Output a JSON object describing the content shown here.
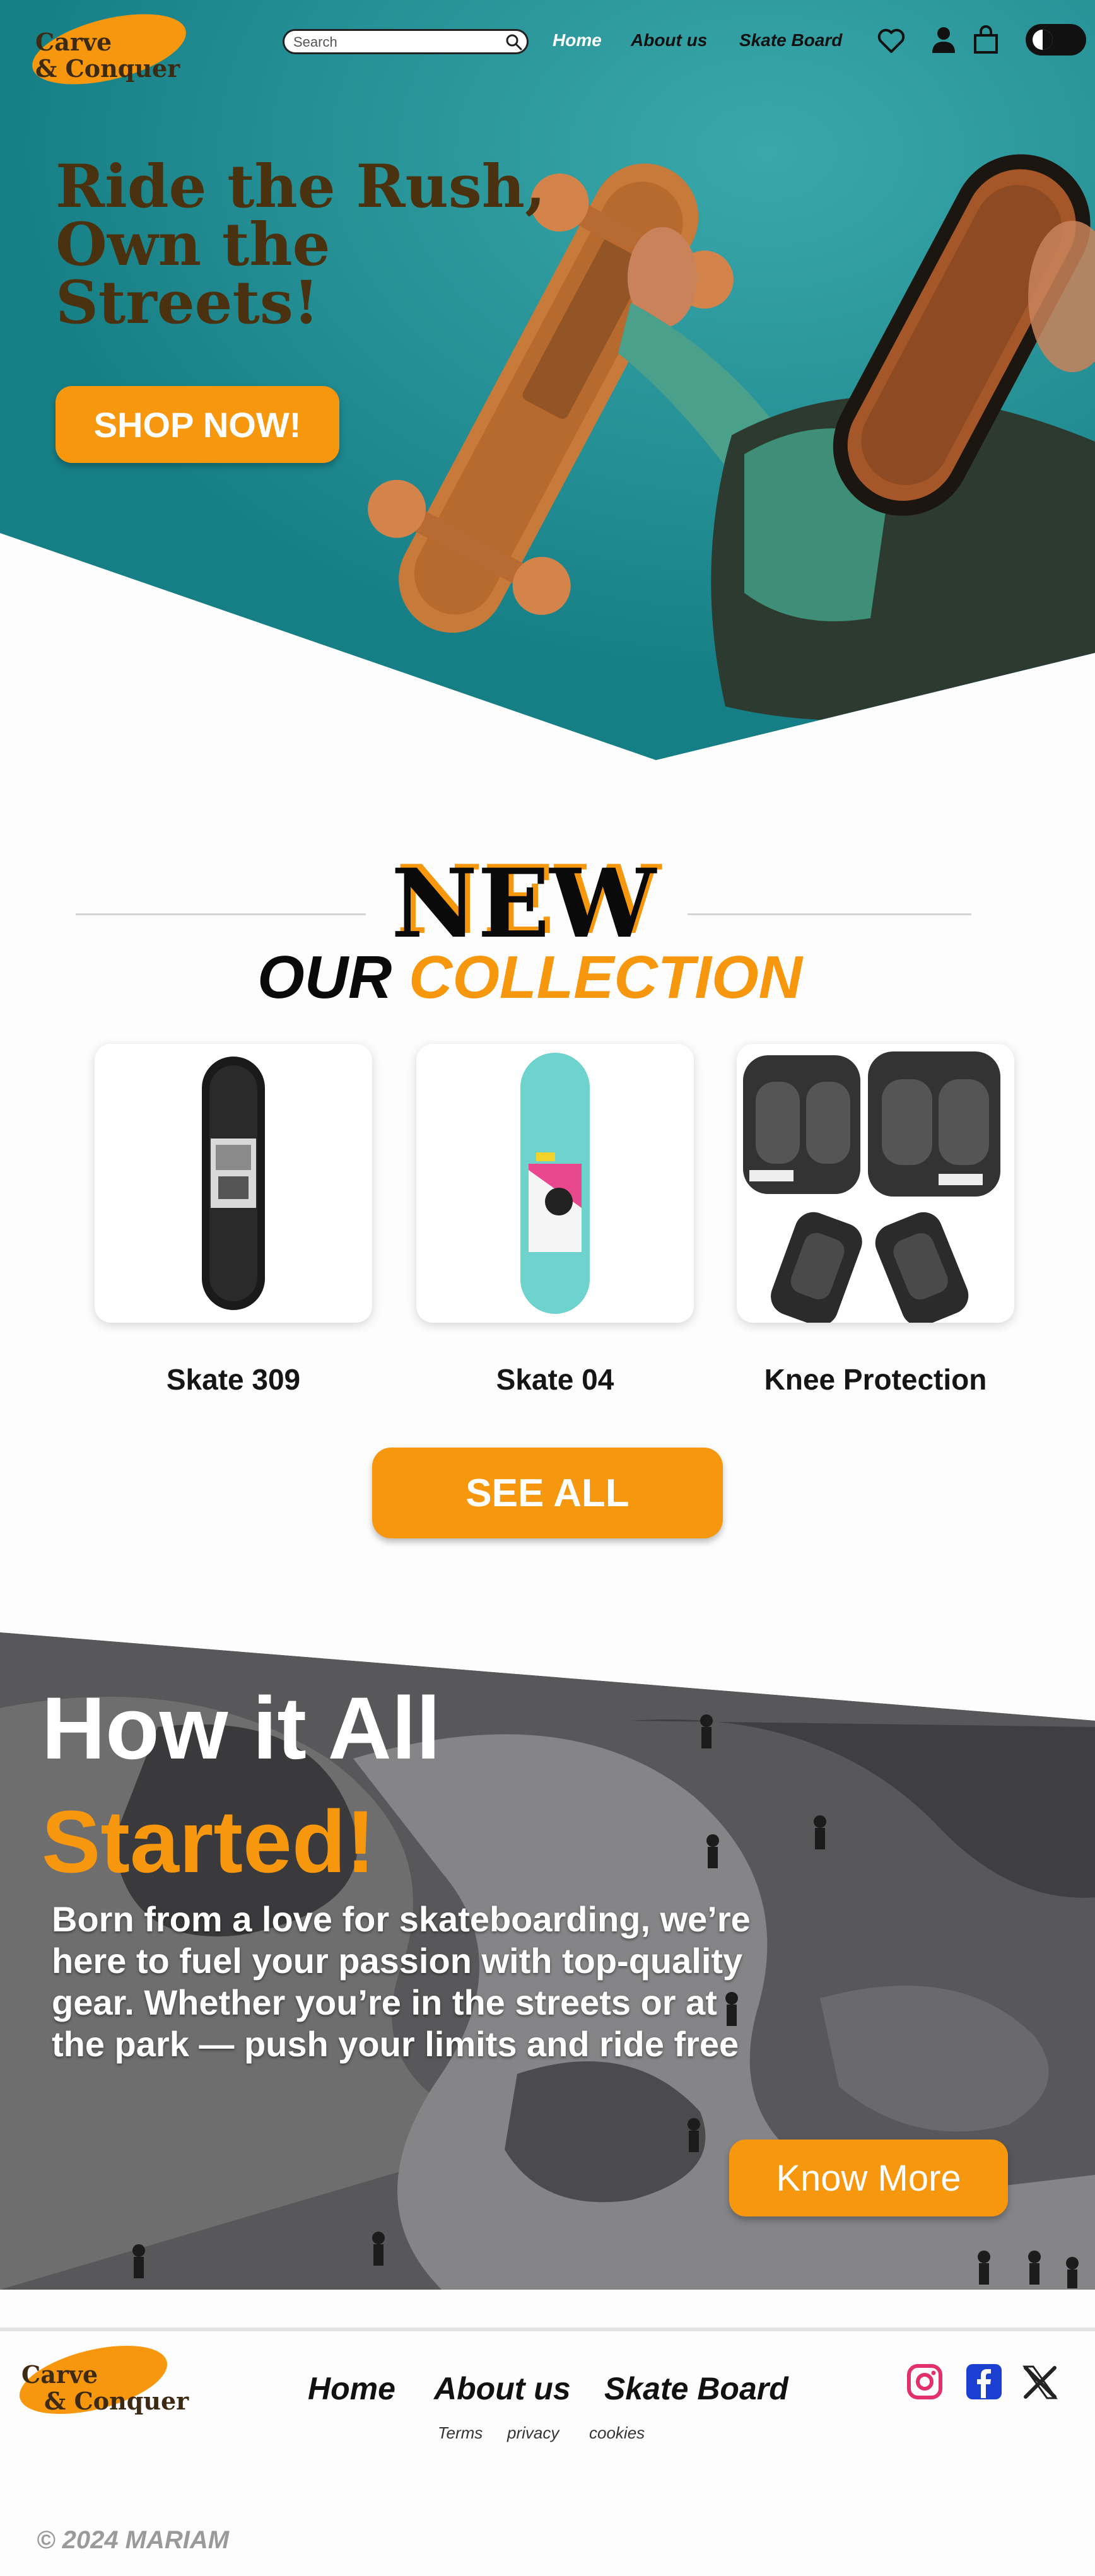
{
  "brand": {
    "line1": "Carve",
    "line2": "& Conquer"
  },
  "header": {
    "search_placeholder": "Search",
    "nav": [
      {
        "label": "Home",
        "active": true
      },
      {
        "label": "About us",
        "active": false
      },
      {
        "label": "Skate Board",
        "active": false
      }
    ],
    "icons": [
      "search-icon",
      "heart-icon",
      "user-icon",
      "bag-icon",
      "theme-toggle-icon"
    ]
  },
  "hero": {
    "title_lines": [
      "Ride the Rush,",
      "Own the",
      "Streets!"
    ],
    "cta_label": "SHOP NOW!"
  },
  "collection": {
    "badge": "NEW",
    "title_word1": "OUR",
    "title_word2": "COLLECTION",
    "products": [
      {
        "name": "Skate 309",
        "image": "black-skateboard-deck"
      },
      {
        "name": "Skate 04",
        "image": "teal-skateboard-deck"
      },
      {
        "name": "Knee Protection",
        "image": "knee-elbow-pads"
      }
    ],
    "see_all_label": "SEE ALL"
  },
  "story": {
    "title_line1": "How it All",
    "title_line2": "Started!",
    "body": "Born from a love for skateboarding, we’re here to fuel your passion with top-quality gear. Whether you’re in the streets or at the park — push your limits and ride free",
    "cta_label": "Know More"
  },
  "footer": {
    "nav": [
      "Home",
      "About us",
      "Skate Board"
    ],
    "legal": [
      "Terms",
      "privacy",
      "cookies"
    ],
    "social": [
      "instagram-icon",
      "facebook-icon",
      "x-icon"
    ],
    "copyright": "© 2024 MARIAM"
  },
  "colors": {
    "accent": "#f7970d",
    "hero_bg": "#1f8f95",
    "heading_brown": "#4a3210",
    "text_dark": "#111111"
  }
}
